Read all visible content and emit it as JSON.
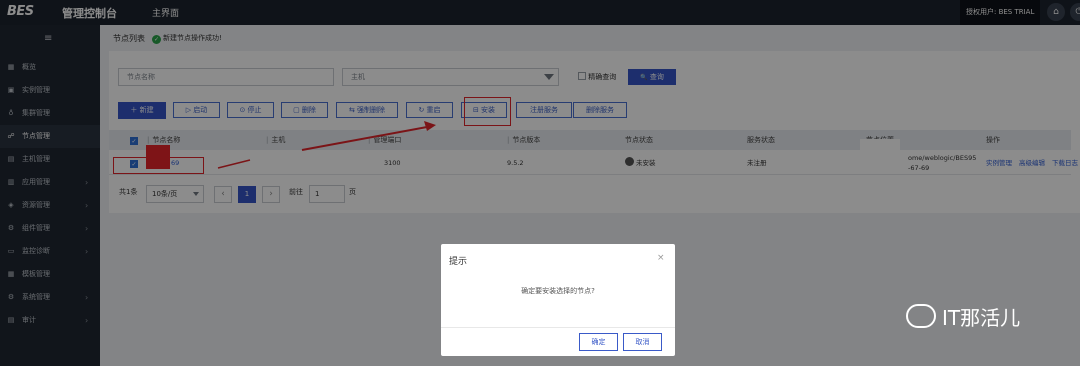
{
  "topbar": {
    "logo": "BES",
    "app_title": "管理控制台",
    "home_tab": "主界面",
    "user": "授权用户: BES TRIAL",
    "home_icon": "⌂",
    "power_icon": "⏻"
  },
  "sidebar": {
    "collapse_icon": "≡",
    "items": [
      {
        "icon": "▦",
        "label": "概览",
        "arrow": ""
      },
      {
        "icon": "▣",
        "label": "实例管理",
        "arrow": ""
      },
      {
        "icon": "♁",
        "label": "集群管理",
        "arrow": ""
      },
      {
        "icon": "☍",
        "label": "节点管理",
        "arrow": ""
      },
      {
        "icon": "▤",
        "label": "主机管理",
        "arrow": ""
      },
      {
        "icon": "▥",
        "label": "应用管理",
        "arrow": "›"
      },
      {
        "icon": "◈",
        "label": "资源管理",
        "arrow": "›"
      },
      {
        "icon": "⚙",
        "label": "组件管理",
        "arrow": "›"
      },
      {
        "icon": "▭",
        "label": "监控诊断",
        "arrow": "›"
      },
      {
        "icon": "▦",
        "label": "模板管理",
        "arrow": ""
      },
      {
        "icon": "⚙",
        "label": "系统管理",
        "arrow": "›"
      },
      {
        "icon": "▤",
        "label": "审计",
        "arrow": "›"
      }
    ]
  },
  "main": {
    "breadcrumb": "节点列表",
    "success_icon": "✓",
    "success_msg": "新建节点操作成功!",
    "search": {
      "node_name_placeholder": "节点名称",
      "host_placeholder": "主机",
      "exact_label": "精确查询",
      "query_label": "查询",
      "query_icon": "🔍"
    },
    "buttons": {
      "new": "＋ 新建",
      "start": "▷ 启动",
      "stop": "⊙ 停止",
      "delete": "▢ 删除",
      "force_delete": "⇆ 强制删除",
      "restart": "↻ 重启",
      "install": "⊟ 安装",
      "register": "注册服务",
      "unregister": "删除服务"
    },
    "table": {
      "headers": [
        "节点名称",
        "主机",
        "管理端口",
        "节点版本",
        "节点状态",
        "服务状态",
        "节点位置",
        "操作"
      ],
      "row": {
        "name": "69",
        "port": "3100",
        "version": "9.5.2",
        "status": "未安装",
        "service": "未注册",
        "location_1": "ome/weblogic/BES95",
        "location_2": "-67-69",
        "action_1": "实例管理",
        "action_2": "高级编辑",
        "action_3": "下载日志"
      }
    },
    "pagination": {
      "total": "共1条",
      "page_size": "10条/页",
      "prev": "‹",
      "current": "1",
      "next": "›",
      "goto_label": "前往",
      "goto_value": "1",
      "page_unit": "页"
    }
  },
  "dialog": {
    "title": "提示",
    "close": "×",
    "message": "确定要安装选择的节点?",
    "confirm": "确定",
    "cancel": "取消"
  },
  "watermark": "IT那活儿",
  "colors": {
    "topbar": "#1c232e",
    "sidebar": "#1f2732",
    "primary": "#3554c7",
    "annotation_red": "#e0252b"
  }
}
